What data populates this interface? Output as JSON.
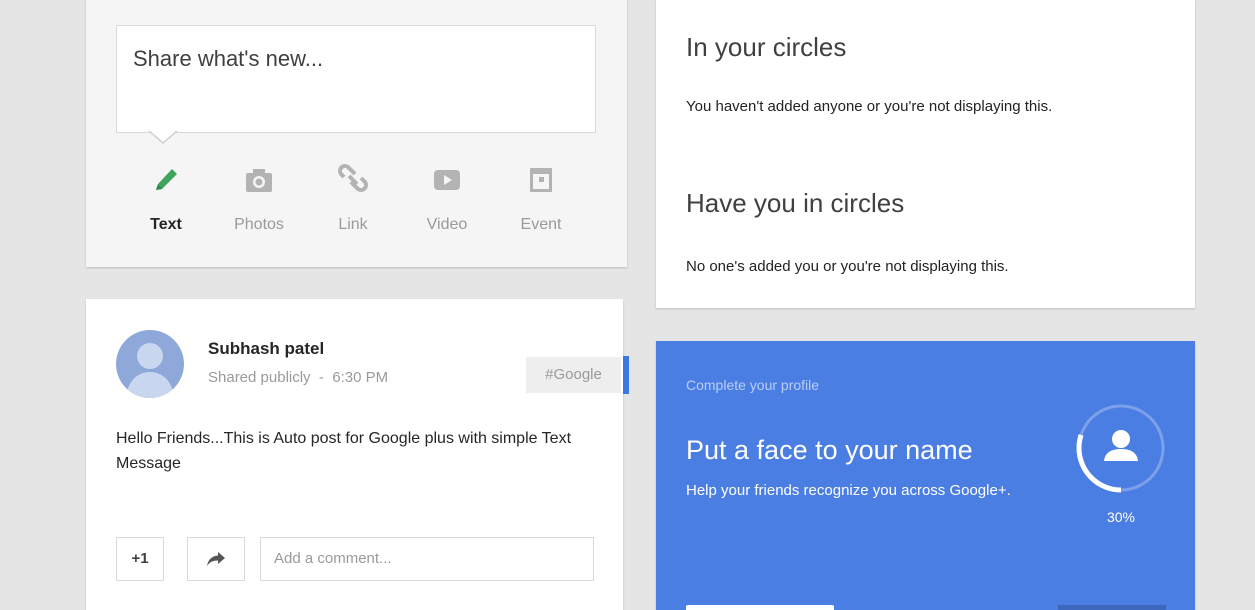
{
  "share": {
    "placeholder": "Share what's new...",
    "options": [
      {
        "label": "Text",
        "icon": "pencil-icon",
        "active": true
      },
      {
        "label": "Photos",
        "icon": "camera-icon",
        "active": false
      },
      {
        "label": "Link",
        "icon": "link-icon",
        "active": false
      },
      {
        "label": "Video",
        "icon": "video-icon",
        "active": false
      },
      {
        "label": "Event",
        "icon": "event-icon",
        "active": false
      }
    ]
  },
  "circles": {
    "in_title": "In your circles",
    "in_text": "You haven't added anyone or you're not displaying this.",
    "have_title": "Have you in circles",
    "have_text": "No one's added you or you're not displaying this."
  },
  "post": {
    "author": "Subhash patel",
    "meta": "Shared publicly  -  6:30 PM",
    "hashtag": "#Google",
    "body": "Hello Friends...This is Auto post for Google plus with simple Text Message",
    "plus_one_label": "+1",
    "comment_placeholder": "Add a comment..."
  },
  "profile": {
    "eyebrow": "Complete your profile",
    "title": "Put a face to your name",
    "description": "Help your friends recognize you across Google+.",
    "progress_label": "30%",
    "progress": 0.3
  },
  "colors": {
    "accent": "#4b7ee3",
    "active_icon": "#3ea55e",
    "background": "#e5e5e5"
  }
}
